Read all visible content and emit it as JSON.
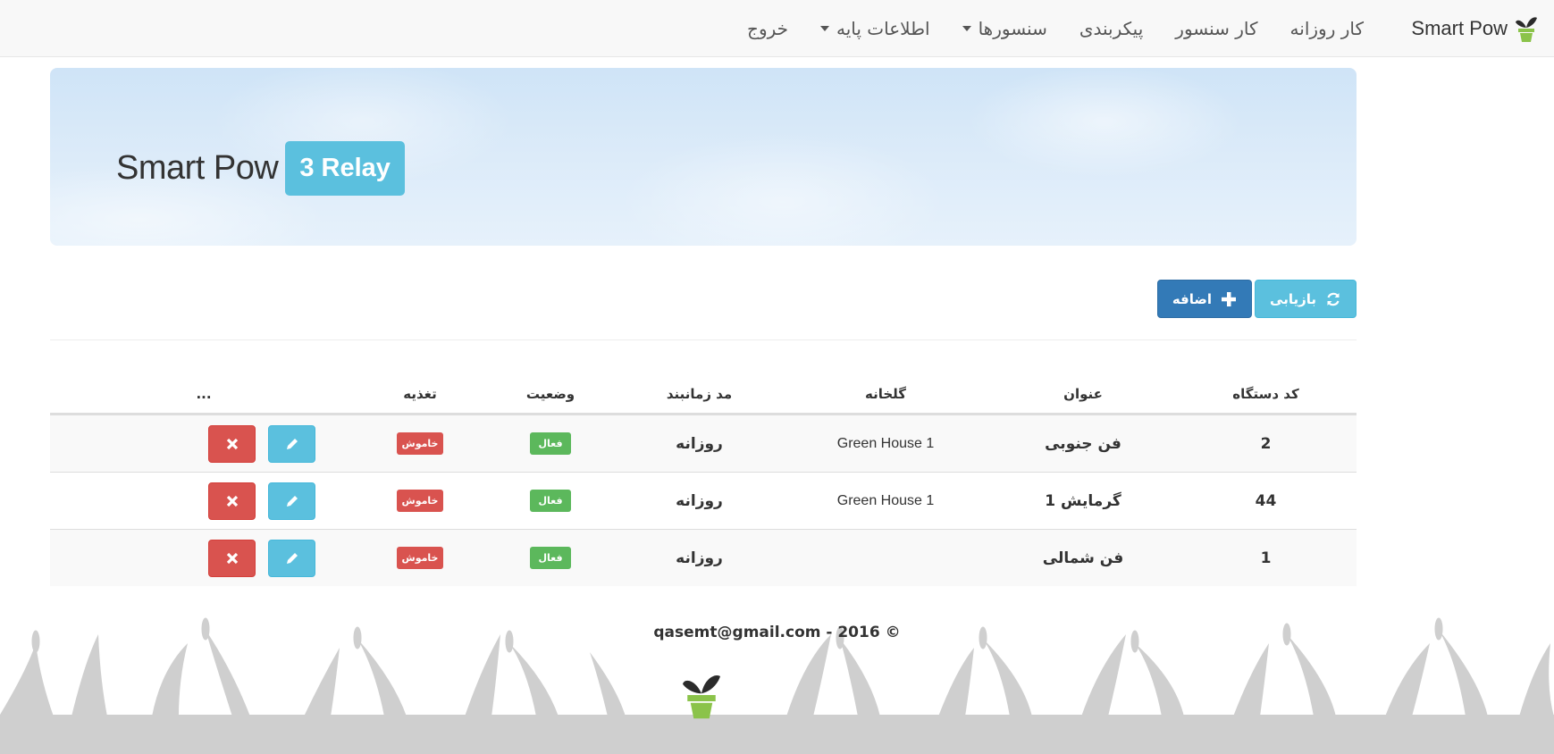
{
  "brand": {
    "name": "Smart Pow"
  },
  "nav": {
    "items": [
      {
        "label": "کار روزانه"
      },
      {
        "label": "کار سنسور"
      },
      {
        "label": "پیکربندی"
      },
      {
        "label": "سنسورها"
      },
      {
        "label": "اطلاعات پایه"
      },
      {
        "label": "خروج"
      }
    ]
  },
  "jumbotron": {
    "title": "Smart Pow",
    "badge": "3 Relay"
  },
  "toolbar": {
    "refresh_label": "بازیابی",
    "add_label": "اضافه"
  },
  "table": {
    "headers": [
      "کد دستگاه",
      "عنوان",
      "گلخانه",
      "مد زمانبند",
      "وضعیت",
      "تغذیه",
      "..."
    ],
    "rows": [
      {
        "code": "2",
        "title": "فن جنوبی",
        "greenhouse": "Green House 1",
        "mode": "روزانه",
        "status": "فعال",
        "power": "خاموش"
      },
      {
        "code": "44",
        "title": "گرمایش 1",
        "greenhouse": "Green House 1",
        "mode": "روزانه",
        "status": "فعال",
        "power": "خاموش"
      },
      {
        "code": "1",
        "title": "فن شمالی",
        "greenhouse": "",
        "mode": "روزانه",
        "status": "فعال",
        "power": "خاموش"
      }
    ]
  },
  "footer": {
    "text": "qasemt@gmail.com - 2016 ©"
  },
  "colors": {
    "primary": "#337ab7",
    "info": "#5bc0de",
    "success": "#5cb85c",
    "danger": "#d9534f",
    "logo_leaf": "#2b2b2b",
    "logo_pot": "#8bc34a"
  },
  "icons": [
    "plant-logo-icon",
    "refresh-icon",
    "plus-icon",
    "pencil-icon",
    "remove-icon",
    "caret-down-icon"
  ]
}
